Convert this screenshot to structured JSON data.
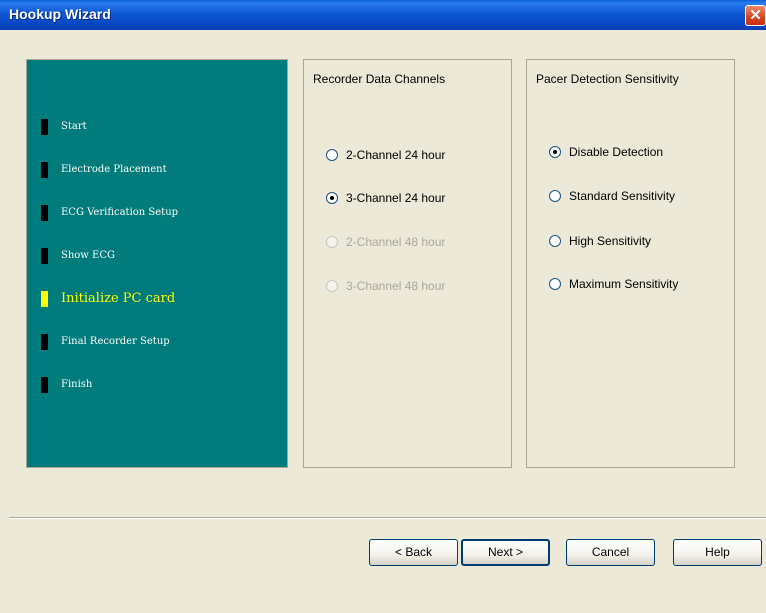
{
  "window": {
    "title": "Hookup Wizard",
    "close_glyph": "✕"
  },
  "steps": [
    {
      "label": "Start",
      "active": false
    },
    {
      "label": "Electrode Placement",
      "active": false
    },
    {
      "label": "ECG Verification Setup",
      "active": false
    },
    {
      "label": "Show ECG",
      "active": false
    },
    {
      "label": "Initialize PC card",
      "active": true
    },
    {
      "label": "Final Recorder Setup",
      "active": false
    },
    {
      "label": "Finish",
      "active": false
    }
  ],
  "recorder_group": {
    "title": "Recorder Data Channels",
    "options": [
      {
        "label": "2-Channel 24 hour",
        "checked": false,
        "enabled": true
      },
      {
        "label": "3-Channel 24 hour",
        "checked": true,
        "enabled": true
      },
      {
        "label": "2-Channel 48 hour",
        "checked": false,
        "enabled": false
      },
      {
        "label": "3-Channel 48 hour",
        "checked": false,
        "enabled": false
      }
    ]
  },
  "pacer_group": {
    "title": "Pacer Detection Sensitivity",
    "options": [
      {
        "label": "Disable Detection",
        "checked": true,
        "enabled": true
      },
      {
        "label": "Standard Sensitivity",
        "checked": false,
        "enabled": true
      },
      {
        "label": "High Sensitivity",
        "checked": false,
        "enabled": true
      },
      {
        "label": "Maximum Sensitivity",
        "checked": false,
        "enabled": true
      }
    ]
  },
  "buttons": {
    "back": "< Back",
    "next": "Next >",
    "cancel": "Cancel",
    "help": "Help"
  },
  "colors": {
    "title_bar": "#0a56d4",
    "steps_panel": "#007b7b",
    "active_step": "#ffff00",
    "dialog_bg": "#ece9d8"
  }
}
